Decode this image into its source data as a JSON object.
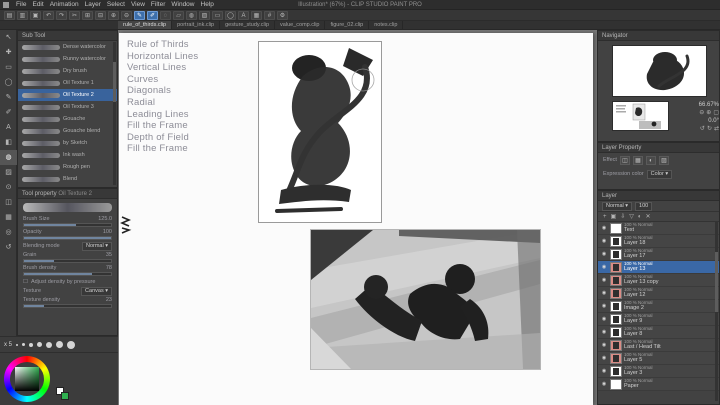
{
  "window": {
    "title": "Illustration* (67%) - CLIP STUDIO PAINT PRO"
  },
  "ui": {
    "caret": "▾",
    "checkbox": "☐",
    "eye": "◉"
  },
  "menubar": {
    "items": [
      "File",
      "Edit",
      "Animation",
      "Layer",
      "Select",
      "View",
      "Filter",
      "Window",
      "Help"
    ]
  },
  "commandbar": {
    "icons": [
      {
        "name": "new-file",
        "glyph": "▤"
      },
      {
        "name": "open-file",
        "glyph": "▥"
      },
      {
        "name": "save",
        "glyph": "▣"
      },
      {
        "name": "undo",
        "glyph": "↶"
      },
      {
        "name": "redo",
        "glyph": "↷"
      },
      {
        "name": "cut",
        "glyph": "✂"
      },
      {
        "name": "copy",
        "glyph": "⊞"
      },
      {
        "name": "paste",
        "glyph": "⊟"
      },
      {
        "name": "zoom-in",
        "glyph": "⊕"
      },
      {
        "name": "zoom-out",
        "glyph": "⊖"
      },
      {
        "name": "pen",
        "glyph": "✎"
      },
      {
        "name": "brush",
        "glyph": "✐"
      },
      {
        "name": "airbrush",
        "glyph": "◌"
      },
      {
        "name": "eraser",
        "glyph": "▱"
      },
      {
        "name": "fill",
        "glyph": "◍"
      },
      {
        "name": "gradient",
        "glyph": "▨"
      },
      {
        "name": "selection",
        "glyph": "▭"
      },
      {
        "name": "lasso",
        "glyph": "◯"
      },
      {
        "name": "text-tool",
        "glyph": "A"
      },
      {
        "name": "grid",
        "glyph": "▦"
      },
      {
        "name": "snap",
        "glyph": "#"
      },
      {
        "name": "settings",
        "glyph": "⚙"
      }
    ]
  },
  "tabbar": {
    "tabs": [
      "rule_of_thirds.clip",
      "portrait_ink.clip",
      "gesture_study.clip",
      "value_comp.clip",
      "figure_02.clip",
      "notes.clip"
    ]
  },
  "toolstrip": {
    "tools": [
      {
        "name": "select",
        "glyph": "↖"
      },
      {
        "name": "move",
        "glyph": "✚"
      },
      {
        "name": "marquee",
        "glyph": "▭"
      },
      {
        "name": "lasso",
        "glyph": "◯"
      },
      {
        "name": "pen",
        "glyph": "✎"
      },
      {
        "name": "pencil",
        "glyph": "✐"
      },
      {
        "name": "text",
        "glyph": "A"
      },
      {
        "name": "fill",
        "glyph": "◧"
      },
      {
        "name": "brush",
        "glyph": "◍"
      },
      {
        "name": "gradient",
        "glyph": "▨"
      },
      {
        "name": "eyedropper",
        "glyph": "⊙"
      },
      {
        "name": "frame",
        "glyph": "◫"
      },
      {
        "name": "grid",
        "glyph": "▦"
      },
      {
        "name": "zoom",
        "glyph": "◎"
      },
      {
        "name": "rotate",
        "glyph": "↺"
      }
    ]
  },
  "subtool": {
    "title": "Sub Tool",
    "brushes": [
      "Dense watercolor",
      "Runny watercolor",
      "Dry brush",
      "Oil Texture 1",
      "Oil Texture 2",
      "Oil Texture 3",
      "Gouache",
      "Gouache blend",
      "by Sketch",
      "Ink wash",
      "Rough pen",
      "Blend"
    ]
  },
  "toolprop": {
    "title": "Tool property",
    "subtitle": "Oil Texture 2",
    "sliders": [
      {
        "label": "Brush Size",
        "value": "125.0"
      },
      {
        "label": "Opacity",
        "value": "100"
      },
      {
        "label": "Blending mode",
        "value": "Normal"
      },
      {
        "label": "Grain",
        "value": "35"
      },
      {
        "label": "Brush density",
        "value": "78"
      }
    ],
    "checkbox_label": "Adjust density by pressure",
    "texture_label": "Texture",
    "texture_value": "Canvas",
    "texture_density_label": "Texture density",
    "texture_density_value": "23"
  },
  "brushsize": {
    "label": "x 5"
  },
  "color": {
    "accent": "#2fae4f"
  },
  "canvas": {
    "list_items": [
      "Rule of Thirds",
      "Horizontal Lines",
      "Vertical Lines",
      "Curves",
      "Diagonals",
      "Radial",
      "Leading Lines",
      "Fill the Frame",
      "Depth of Field",
      "Fill the Frame"
    ]
  },
  "navigator": {
    "title": "Navigator",
    "zoom": "66.67%",
    "rotation": "0.0°",
    "icons": [
      {
        "name": "zoom-out",
        "glyph": "⊖"
      },
      {
        "name": "zoom-in",
        "glyph": "⊕"
      },
      {
        "name": "fit-to-screen",
        "glyph": "▢"
      },
      {
        "name": "rotate-left",
        "glyph": "↺"
      },
      {
        "name": "rotate-right",
        "glyph": "↻"
      },
      {
        "name": "flip-horizontal",
        "glyph": "⇄"
      }
    ]
  },
  "layerprop": {
    "title": "Layer Property",
    "effect_label": "Effect",
    "effect_icons": [
      {
        "name": "border-effect",
        "glyph": "◫"
      },
      {
        "name": "tone-effect",
        "glyph": "▦"
      },
      {
        "name": "layer-color-effect",
        "glyph": "◐"
      },
      {
        "name": "extract-line-effect",
        "glyph": "▨"
      }
    ],
    "expression_label": "Expression color",
    "expression_value": "Color"
  },
  "layers": {
    "title": "Layer",
    "blend_label": "Normal",
    "opacity_value": "100",
    "toolbar_icons": [
      {
        "name": "new-layer",
        "glyph": "+"
      },
      {
        "name": "new-folder",
        "glyph": "▣"
      },
      {
        "name": "transfer-down",
        "glyph": "⇩"
      },
      {
        "name": "merge-down",
        "glyph": "▽"
      },
      {
        "name": "layer-mask",
        "glyph": "◐"
      },
      {
        "name": "delete-layer",
        "glyph": "✕"
      }
    ],
    "rows": [
      {
        "blend": "100 % Normal",
        "name": "Text"
      },
      {
        "blend": "100 % Normal",
        "name": "Layer 18"
      },
      {
        "blend": "100 % Normal",
        "name": "Layer 17"
      },
      {
        "blend": "100 % Normal",
        "name": "Layer 13"
      },
      {
        "blend": "100 % Normal",
        "name": "Layer 13 copy"
      },
      {
        "blend": "100 % Normal",
        "name": "Layer 12"
      },
      {
        "blend": "100 % Normal",
        "name": "Image 2"
      },
      {
        "blend": "100 % Normal",
        "name": "Layer 9"
      },
      {
        "blend": "100 % Normal",
        "name": "Layer 8"
      },
      {
        "blend": "100 % Normal",
        "name": "Last / Head Tilt"
      },
      {
        "blend": "100 % Normal",
        "name": "Layer 5"
      },
      {
        "blend": "100 % Normal",
        "name": "Layer 3"
      },
      {
        "blend": "100 % Normal",
        "name": "Paper"
      }
    ]
  }
}
